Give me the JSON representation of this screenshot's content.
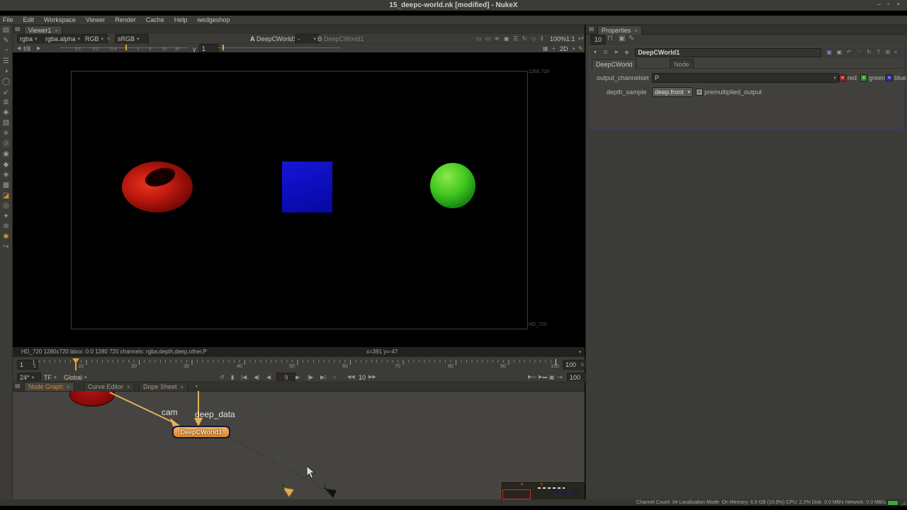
{
  "window": {
    "title": "15_deepc-world.nk [modified] - NukeX",
    "minimize": "–",
    "maximize": "▫",
    "close": "▪"
  },
  "menubar": {
    "items": [
      "File",
      "Edit",
      "Workspace",
      "Viewer",
      "Render",
      "Cache",
      "Help",
      "wedgeshop"
    ]
  },
  "tools": [
    "▤",
    "✎",
    "◔",
    "☰",
    "◑",
    "◯",
    "↙",
    "≣",
    "✚",
    "▧",
    "✳",
    "Ⓓ",
    "◉",
    "◆",
    "◈",
    "▦",
    "◪",
    "◎",
    "✦",
    "⊛",
    "✱",
    "↪"
  ],
  "viewer": {
    "pane_icon": "▤",
    "tab": "Viewer1",
    "tab_close": "×",
    "layer": "rgba",
    "alpha": "rgba.alpha",
    "display": "RGB",
    "lut_icon": "≈",
    "colorspace": "sRGB",
    "caret": "▾",
    "a_label": "A",
    "a_node": "DeepCWorld1",
    "ab_mode": "-",
    "b_label": "B",
    "b_node": "DeepCWorld1",
    "icons": [
      "▭",
      "▭",
      "≋",
      "▣",
      "☰",
      "↻",
      "◇",
      "‖"
    ],
    "zoom": "100%",
    "ratio": "1:1",
    "wipe_icon": "⚡",
    "gain_prev": "◀",
    "gain_stop": "f/8",
    "gain_next": "▶",
    "gain_ticks": [
      "0.1",
      "0.2",
      "0.4",
      "1",
      "2",
      "4",
      "10",
      "30"
    ],
    "gamma_label": "γ",
    "gamma_value": "1",
    "roi_icon": "▦",
    "axis_icon": "+",
    "view_mode": "2D",
    "pencil_icon": "✎",
    "res_label": "1280,720",
    "format_label": "HD_720",
    "status": "HD_720 1280x720  bbox: 0 0 1280 720  channels: rgba,depth,deep,other,P",
    "pointer": "x=391 y=-47"
  },
  "timeline": {
    "frame_field": "1",
    "labels": [
      "1",
      "10",
      "20",
      "30",
      "40",
      "50",
      "60",
      "70",
      "80",
      "90",
      "100"
    ],
    "range_end": "100",
    "range_end2": "100",
    "range_caret": "⋎",
    "fps": "24*",
    "tf": "TF",
    "range_mode": "Global",
    "t_loop": "↺",
    "t_bar": "▮",
    "t_first": "|◀",
    "t_prevkey": "◀|",
    "t_prev": "◀",
    "current": "9",
    "t_play": "▶",
    "t_next": "|▶",
    "t_nextkey": "▶|",
    "t_mode": "○",
    "dec": "◀◀",
    "increment": "10",
    "inc": "▶▶",
    "r1": "▶▭",
    "r2": "▶▬",
    "r3": "▣",
    "r4": "⇥"
  },
  "node_graph": {
    "pane_icon": "▤",
    "tabs": [
      "Node Graph",
      "Curve Editor",
      "Dope Sheet"
    ],
    "tab_close": "×",
    "cam_label": "cam",
    "deep_label": "deep_data",
    "node_label": "DeepCWorld1",
    "in1": "1",
    "in2": "2"
  },
  "properties": {
    "pane_icon": "▤",
    "tab": "Properties",
    "tab_close": "×",
    "max_panels": "10",
    "lock_icon": "⊓",
    "panel_icon": "▣",
    "edit_icon": "✎",
    "h_filter": "▾",
    "h_center": "⊙",
    "h_arrow": "➤",
    "h_key": "◈",
    "title": "DeepCWorld1",
    "h_r1": "▣",
    "h_r2": "▣",
    "h_r3": "↶",
    "h_r4": "↷",
    "h_r5": "↻",
    "h_r6": "?",
    "h_r7": "⊞",
    "h_r8": "×",
    "tab1": "DeepCWorld",
    "tab2": "Node",
    "output_label": "output_channelset",
    "output_value": "P",
    "cb_x": "×",
    "cb_red": "red",
    "cb_green": "green",
    "cb_blue": "blue",
    "cb_extra": "▬",
    "depth_label": "depth_sample",
    "depth_value": "deep.front",
    "premult_label": "premultiplied_output"
  },
  "statusbar": {
    "text": "Channel Count: 34  Localization Mode: On  Memory: 6.9 GB (10.9%) CPU: 2.2% Disk: 0.0 MB/s Network: 0.0 MB/s"
  }
}
